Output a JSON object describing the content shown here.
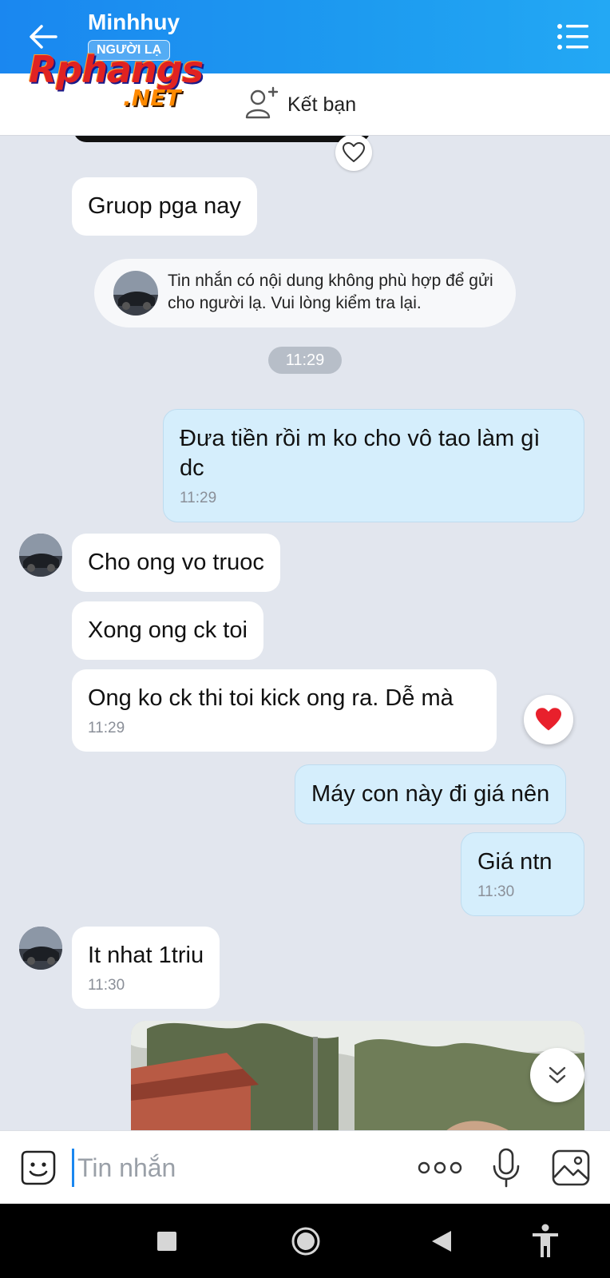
{
  "header": {
    "contact_name": "Minhhuy",
    "stranger_badge": "NGƯỜI LẠ",
    "watermark_main": "Rphangs",
    "watermark_net": ".NET"
  },
  "friend_bar": {
    "add_friend_label": "Kết bạn"
  },
  "warning": {
    "text": "Tin nhắn có nội dung không phù hợp để gửi cho người lạ. Vui lòng kiểm tra lại."
  },
  "time_divider": "11:29",
  "messages": [
    {
      "dir": "in",
      "text": "Gruop pga nay",
      "time": ""
    },
    {
      "dir": "out",
      "text": "Đưa tiền rồi m ko cho vô tao làm gì dc",
      "time": "11:29"
    },
    {
      "dir": "in",
      "text": "Cho ong vo truoc",
      "time": ""
    },
    {
      "dir": "in",
      "text": "Xong ong ck toi",
      "time": ""
    },
    {
      "dir": "in",
      "text": "Ong ko ck thi toi kick ong ra. Dễ mà",
      "time": "11:29"
    },
    {
      "dir": "out",
      "text": "Máy con này đi giá nên",
      "time": ""
    },
    {
      "dir": "out",
      "text": "Giá ntn",
      "time": "11:30"
    },
    {
      "dir": "in",
      "text": "It nhat 1triu",
      "time": "11:30"
    }
  ],
  "input": {
    "placeholder": "Tin nhắn"
  },
  "colors": {
    "header_blue": "#1d9bf0",
    "outgoing_bubble": "#d5eefc",
    "incoming_bubble": "#ffffff",
    "chat_background": "#e2e6ee",
    "reaction_heart": "#e8202c"
  }
}
